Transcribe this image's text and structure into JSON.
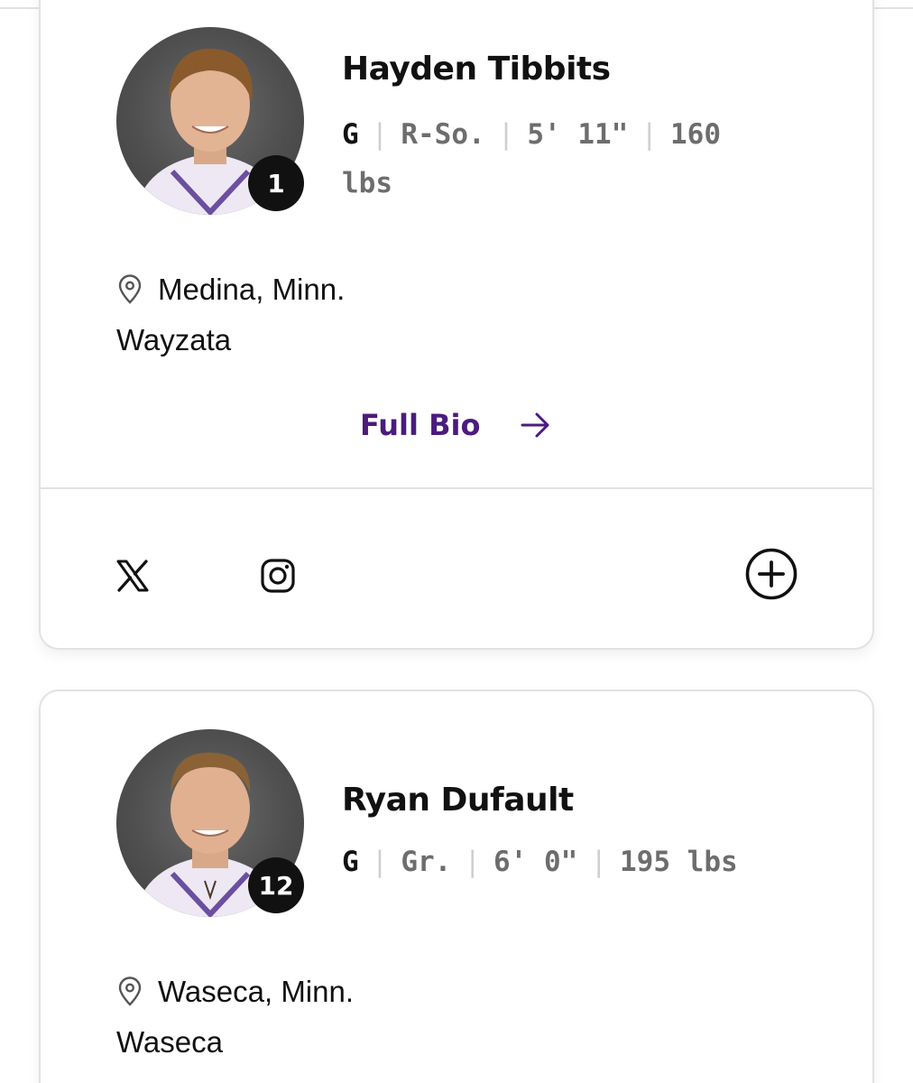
{
  "roster": {
    "players": [
      {
        "name": "Hayden Tibbits",
        "number": "1",
        "position": "G",
        "class": "R-So.",
        "height": "5' 11\"",
        "weight_line1": "160",
        "weight_line2": "lbs",
        "hometown": "Medina, Minn.",
        "high_school": "Wayzata",
        "full_bio_label": "Full Bio"
      },
      {
        "name": "Ryan Dufault",
        "number": "12",
        "position": "G",
        "class": "Gr.",
        "height": "6' 0\"",
        "weight": "195 lbs",
        "hometown": "Waseca, Minn.",
        "high_school": "Waseca"
      }
    ]
  },
  "icons": {
    "location": "location-pin-icon",
    "full_bio_arrow": "arrow-right-icon",
    "x": "x-twitter-icon",
    "instagram": "instagram-icon",
    "expand": "plus-circle-icon"
  },
  "colors": {
    "accent_purple": "#4b1b7e",
    "header_bar": "#2a1f52",
    "badge_bg": "#111111",
    "meta_gray": "#6d6d6d"
  }
}
